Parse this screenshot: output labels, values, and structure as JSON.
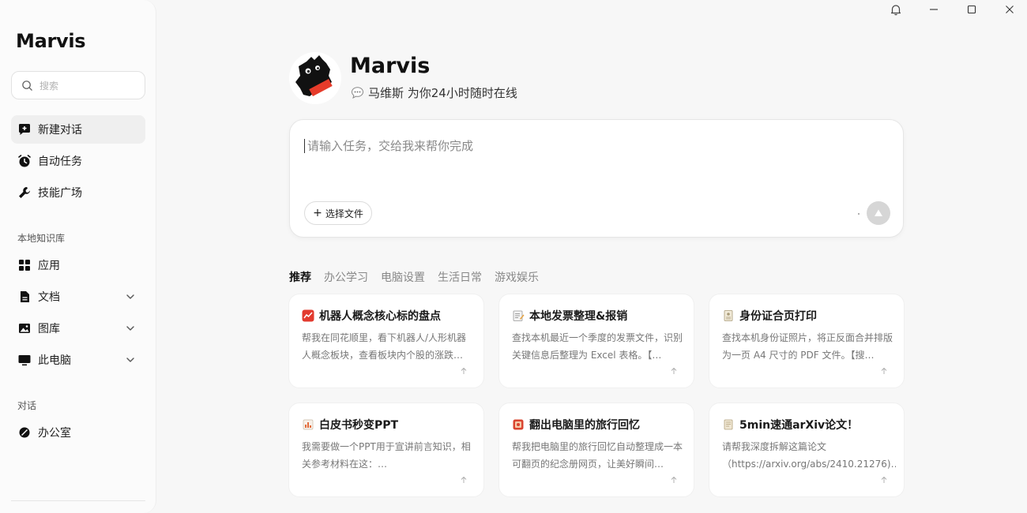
{
  "app": {
    "title": "Marvis"
  },
  "sidebar": {
    "search_placeholder": "搜索",
    "nav": [
      {
        "label": "新建对话",
        "icon": "chat-plus-icon",
        "active": true
      },
      {
        "label": "自动任务",
        "icon": "alarm-clock-icon"
      },
      {
        "label": "技能广场",
        "icon": "wrench-icon"
      }
    ],
    "knowledge_label": "本地知识库",
    "knowledge": [
      {
        "label": "应用",
        "icon": "apps-grid-icon"
      },
      {
        "label": "文档",
        "icon": "document-icon"
      },
      {
        "label": "图库",
        "icon": "image-icon"
      },
      {
        "label": "此电脑",
        "icon": "monitor-icon"
      }
    ],
    "conversation_label": "对话",
    "conversations": [
      {
        "label": "办公室",
        "icon": "leaf-icon"
      }
    ]
  },
  "window_controls": [
    "bell-icon",
    "minimize-icon",
    "maximize-icon",
    "close-icon"
  ],
  "profile": {
    "name": "Marvis",
    "subtitle": "马维斯 为你24小时随时在线"
  },
  "composer": {
    "placeholder": "请输入任务，交给我来帮你完成",
    "file_button": "选择文件"
  },
  "tabs": [
    "推荐",
    "办公学习",
    "电脑设置",
    "生活日常",
    "游戏娱乐"
  ],
  "cards": [
    {
      "title": "机器人概念核心标的盘点",
      "icon": "stock-chart-icon",
      "desc": "帮我在同花顺里，看下机器人/人形机器人概念板块，查看板块内个股的涨跌…"
    },
    {
      "title": "本地发票整理&报销",
      "icon": "memo-icon",
      "desc": "查找本机最近一个季度的发票文件，识别关键信息后整理为 Excel 表格。【…"
    },
    {
      "title": "身份证合页打印",
      "icon": "id-card-icon",
      "desc": "查找本机身份证照片，将正反面合并排版为一页 A4 尺寸的 PDF 文件。【搜…"
    },
    {
      "title": "白皮书秒变PPT",
      "icon": "bar-chart-icon",
      "desc": "我需要做一个PPT用于宣讲前言知识，相关参考材料在这：…"
    },
    {
      "title": "翻出电脑里的旅行回忆",
      "icon": "photo-album-icon",
      "desc": "帮我把电脑里的旅行回忆自动整理成一本可翻页的纪念册网页，让美好瞬间…"
    },
    {
      "title": "5min速通arXiv论文！",
      "icon": "scroll-icon",
      "desc": "请帮我深度拆解这篇论文（https://arxiv.org/abs/2410.21276)…"
    }
  ]
}
